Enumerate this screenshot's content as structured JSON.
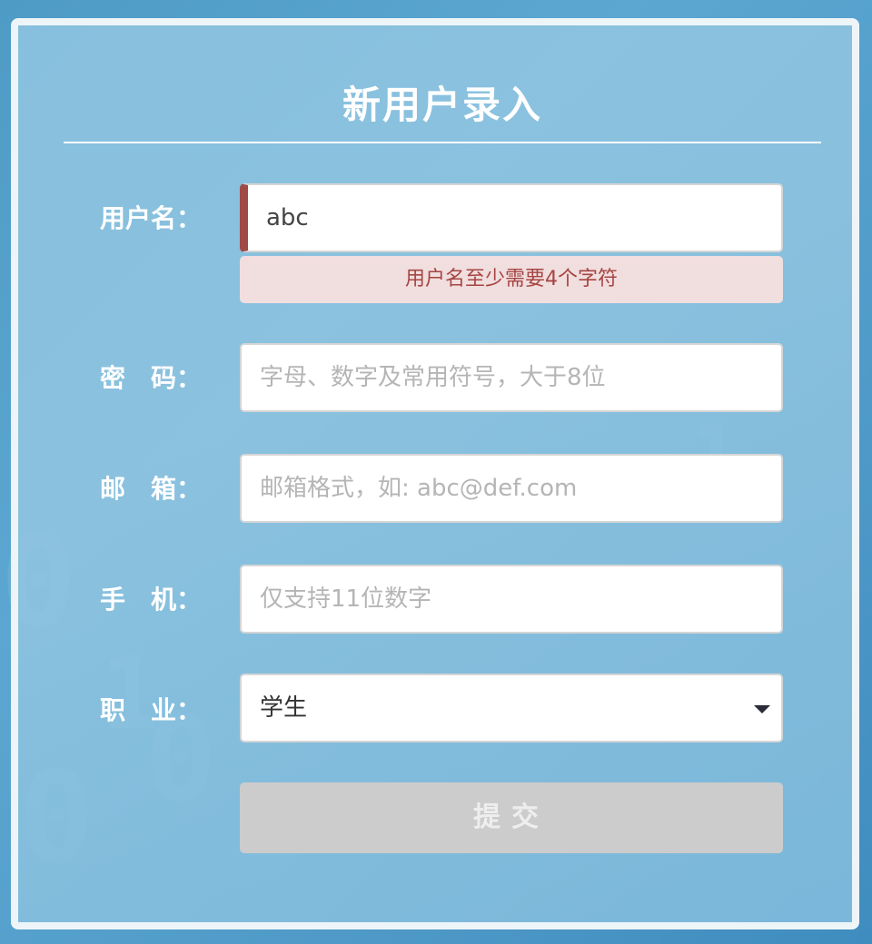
{
  "form": {
    "title": "新用户录入",
    "username": {
      "label": "用户名：",
      "value": "abc",
      "error": "用户名至少需要4个字符"
    },
    "password": {
      "label": "密　码：",
      "placeholder": "字母、数字及常用符号，大于8位"
    },
    "email": {
      "label": "邮　箱：",
      "placeholder": "邮箱格式，如: abc@def.com"
    },
    "phone": {
      "label": "手　机：",
      "placeholder": "仅支持11位数字"
    },
    "occupation": {
      "label": "职　业：",
      "selected": "学生"
    },
    "submit_label": "提交"
  }
}
